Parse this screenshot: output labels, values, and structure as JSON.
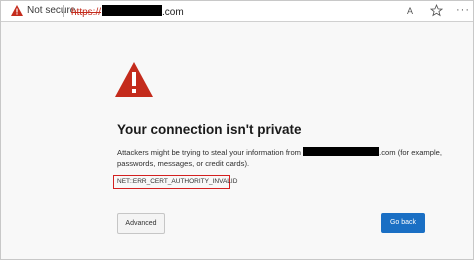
{
  "address_bar": {
    "security_label": "Not secure",
    "url_scheme": "https://",
    "url_suffix": ".com",
    "read_aloud_glyph": "A",
    "favorite_icon": "star-icon",
    "more_glyph": "···"
  },
  "interstitial": {
    "title": "Your connection isn't private",
    "description_prefix": "Attackers might be trying to steal your information from ",
    "description_suffix": ".com (for example, passwords, messages, or credit cards).",
    "error_code": "NET::ERR_CERT_AUTHORITY_INVALID",
    "advanced_label": "Advanced",
    "go_back_label": "Go back"
  },
  "colors": {
    "warning_red": "#c42b1c",
    "primary_blue": "#1a6fc4"
  }
}
